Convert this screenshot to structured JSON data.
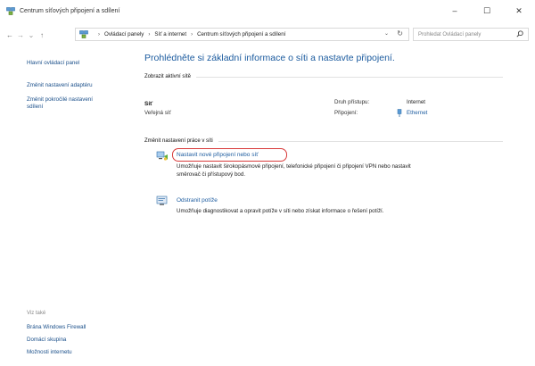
{
  "window": {
    "title": "Centrum síťových připojení a sdílení",
    "controls": {
      "minimize": "–",
      "maximize": "☐",
      "close": "✕"
    }
  },
  "nav": {
    "back": "←",
    "forward": "→",
    "recent": "⌄",
    "up": "↑",
    "breadcrumbs": [
      "Ovládací panely",
      "Síť a internet",
      "Centrum síťových připojení a sdílení"
    ],
    "separator": "›",
    "dropdown_glyph": "⌄",
    "refresh_glyph": "↻",
    "search_placeholder": "Prohledat Ovládací panely"
  },
  "sidebar": {
    "links": [
      "Hlavní ovládací panel",
      "Změnit nastavení adaptéru",
      "Změnit pokročilé nastavení",
      "sdílení"
    ],
    "see_also_heading": "Viz také",
    "see_also": [
      "Brána Windows Firewall",
      "Domácí skupina",
      "Možnosti internetu"
    ]
  },
  "main": {
    "title": "Prohlédněte si základní informace o síti a nastavte připojení.",
    "active_networks_heading": "Zobrazit aktivní sítě",
    "network": {
      "name": "Síť",
      "type": "Veřejná síť",
      "access_label": "Druh přístupu:",
      "access_value": "Internet",
      "connections_label": "Připojení:",
      "connections_value": "Ethernet"
    },
    "change_heading": "Změnit nastavení práce v síti",
    "tasks": [
      {
        "link": "Nastavit nové připojení nebo síť",
        "desc_line1": "Umožňuje nastavit širokopásmové připojení, telefonické připojení či připojení VPN nebo nastavit",
        "desc_line2": "směrovač či přístupový bod."
      },
      {
        "link": "Odstranit potíže",
        "desc_line1": "Umožňuje diagnostikovat a opravit potíže v síti nebo získat informace o řešení potíží."
      }
    ]
  },
  "colors": {
    "link": "#1a5a9e",
    "highlight": "#d83a3a"
  },
  "icons": [
    "network-center-icon",
    "network-setup-icon",
    "troubleshoot-icon",
    "ethernet-icon",
    "search-icon"
  ]
}
